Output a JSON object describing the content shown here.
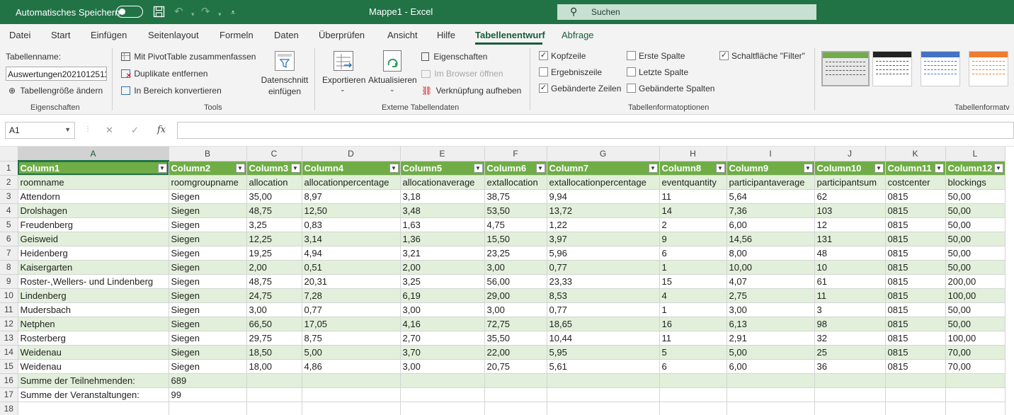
{
  "titlebar": {
    "autosave_label": "Automatisches Speichern",
    "window_title": "Mappe1  -  Excel",
    "search_placeholder": "Suchen"
  },
  "menu": {
    "items": [
      "Datei",
      "Start",
      "Einfügen",
      "Seitenlayout",
      "Formeln",
      "Daten",
      "Überprüfen",
      "Ansicht",
      "Hilfe",
      "Tabellenentwurf",
      "Abfrage"
    ],
    "active": "Tabellenentwurf"
  },
  "ribbon": {
    "eigenschaften": {
      "table_name_label": "Tabellenname:",
      "table_name_value": "Auswertungen2021012511",
      "resize_label": "Tabellengröße ändern",
      "group_label": "Eigenschaften"
    },
    "tools": {
      "pivot_label": "Mit PivotTable zusammenfassen",
      "dup_label": "Duplikate entfernen",
      "convert_label": "In Bereich konvertieren",
      "slicer_line1": "Datenschnitt",
      "slicer_line2": "einfügen",
      "group_label": "Tools"
    },
    "extern": {
      "export_label": "Exportieren",
      "refresh_label": "Aktualisieren",
      "props_label": "Eigenschaften",
      "browser_label": "Im Browser öffnen",
      "unlink_label": "Verknüpfung aufheben",
      "group_label": "Externe Tabellendaten"
    },
    "formatoptions": {
      "kopfzeile": "Kopfzeile",
      "ergebniszeile": "Ergebniszeile",
      "gebaenderte_zeilen": "Gebänderte Zeilen",
      "erste_spalte": "Erste Spalte",
      "letzte_spalte": "Letzte Spalte",
      "gebaenderte_spalten": "Gebänderte Spalten",
      "filter_button": "Schaltfläche \"Filter\"",
      "group_label": "Tabellenformatoptionen"
    },
    "styles": {
      "group_label": "Tabellenformatv",
      "colors": [
        "#70ad47",
        "#222222",
        "#4472c4",
        "#ed7d31"
      ]
    }
  },
  "formula_bar": {
    "name_box": "A1",
    "cancel_icon": "✕",
    "enter_icon": "✓",
    "fx_label": "fx"
  },
  "grid": {
    "columns": [
      "A",
      "B",
      "C",
      "D",
      "E",
      "F",
      "G",
      "H",
      "I",
      "J",
      "K",
      "L"
    ],
    "header_row": [
      "Column1",
      "Column2",
      "Column3",
      "Column4",
      "Column5",
      "Column6",
      "Column7",
      "Column8",
      "Column9",
      "Column10",
      "Column11",
      "Column12"
    ],
    "rows": [
      [
        "roomname",
        "roomgroupname",
        "allocation",
        "allocationpercentage",
        "allocationaverage",
        "extallocation",
        "extallocationpercentage",
        "eventquantity",
        "participantaverage",
        "participantsum",
        "costcenter",
        "blockings"
      ],
      [
        "Attendorn",
        "Siegen",
        "35,00",
        "8,97",
        "3,18",
        "38,75",
        "9,94",
        "11",
        "5,64",
        "62",
        "0815",
        "50,00"
      ],
      [
        "Drolshagen",
        "Siegen",
        "48,75",
        "12,50",
        "3,48",
        "53,50",
        "13,72",
        "14",
        "7,36",
        "103",
        "0815",
        "50,00"
      ],
      [
        "Freudenberg",
        "Siegen",
        "3,25",
        "0,83",
        "1,63",
        "4,75",
        "1,22",
        "2",
        "6,00",
        "12",
        "0815",
        "50,00"
      ],
      [
        "Geisweid",
        "Siegen",
        "12,25",
        "3,14",
        "1,36",
        "15,50",
        "3,97",
        "9",
        "14,56",
        "131",
        "0815",
        "50,00"
      ],
      [
        "Heidenberg",
        "Siegen",
        "19,25",
        "4,94",
        "3,21",
        "23,25",
        "5,96",
        "6",
        "8,00",
        "48",
        "0815",
        "50,00"
      ],
      [
        "Kaisergarten",
        "Siegen",
        "2,00",
        "0,51",
        "2,00",
        "3,00",
        "0,77",
        "1",
        "10,00",
        "10",
        "0815",
        "50,00"
      ],
      [
        "Roster-,Wellers- und Lindenberg",
        "Siegen",
        "48,75",
        "20,31",
        "3,25",
        "56,00",
        "23,33",
        "15",
        "4,07",
        "61",
        "0815",
        "200,00"
      ],
      [
        "Lindenberg",
        "Siegen",
        "24,75",
        "7,28",
        "6,19",
        "29,00",
        "8,53",
        "4",
        "2,75",
        "11",
        "0815",
        "100,00"
      ],
      [
        "Mudersbach",
        "Siegen",
        "3,00",
        "0,77",
        "3,00",
        "3,00",
        "0,77",
        "1",
        "3,00",
        "3",
        "0815",
        "50,00"
      ],
      [
        "Netphen",
        "Siegen",
        "66,50",
        "17,05",
        "4,16",
        "72,75",
        "18,65",
        "16",
        "6,13",
        "98",
        "0815",
        "50,00"
      ],
      [
        "Rosterberg",
        "Siegen",
        "29,75",
        "8,75",
        "2,70",
        "35,50",
        "10,44",
        "11",
        "2,91",
        "32",
        "0815",
        "100,00"
      ],
      [
        "Weidenau",
        "Siegen",
        "18,50",
        "5,00",
        "3,70",
        "22,00",
        "5,95",
        "5",
        "5,00",
        "25",
        "0815",
        "70,00"
      ],
      [
        "Weidenau",
        "Siegen",
        "18,00",
        "4,86",
        "3,00",
        "20,75",
        "5,61",
        "6",
        "6,00",
        "36",
        "0815",
        "70,00"
      ],
      [
        "Summe der Teilnehmenden:",
        "689",
        "",
        "",
        "",
        "",
        "",
        "",
        "",
        "",
        "",
        ""
      ],
      [
        "Summe der Veranstaltungen:",
        "99",
        "",
        "",
        "",
        "",
        "",
        "",
        "",
        "",
        "",
        ""
      ],
      [
        "",
        "",
        "",
        "",
        "",
        "",
        "",
        "",
        "",
        "",
        "",
        ""
      ]
    ]
  }
}
